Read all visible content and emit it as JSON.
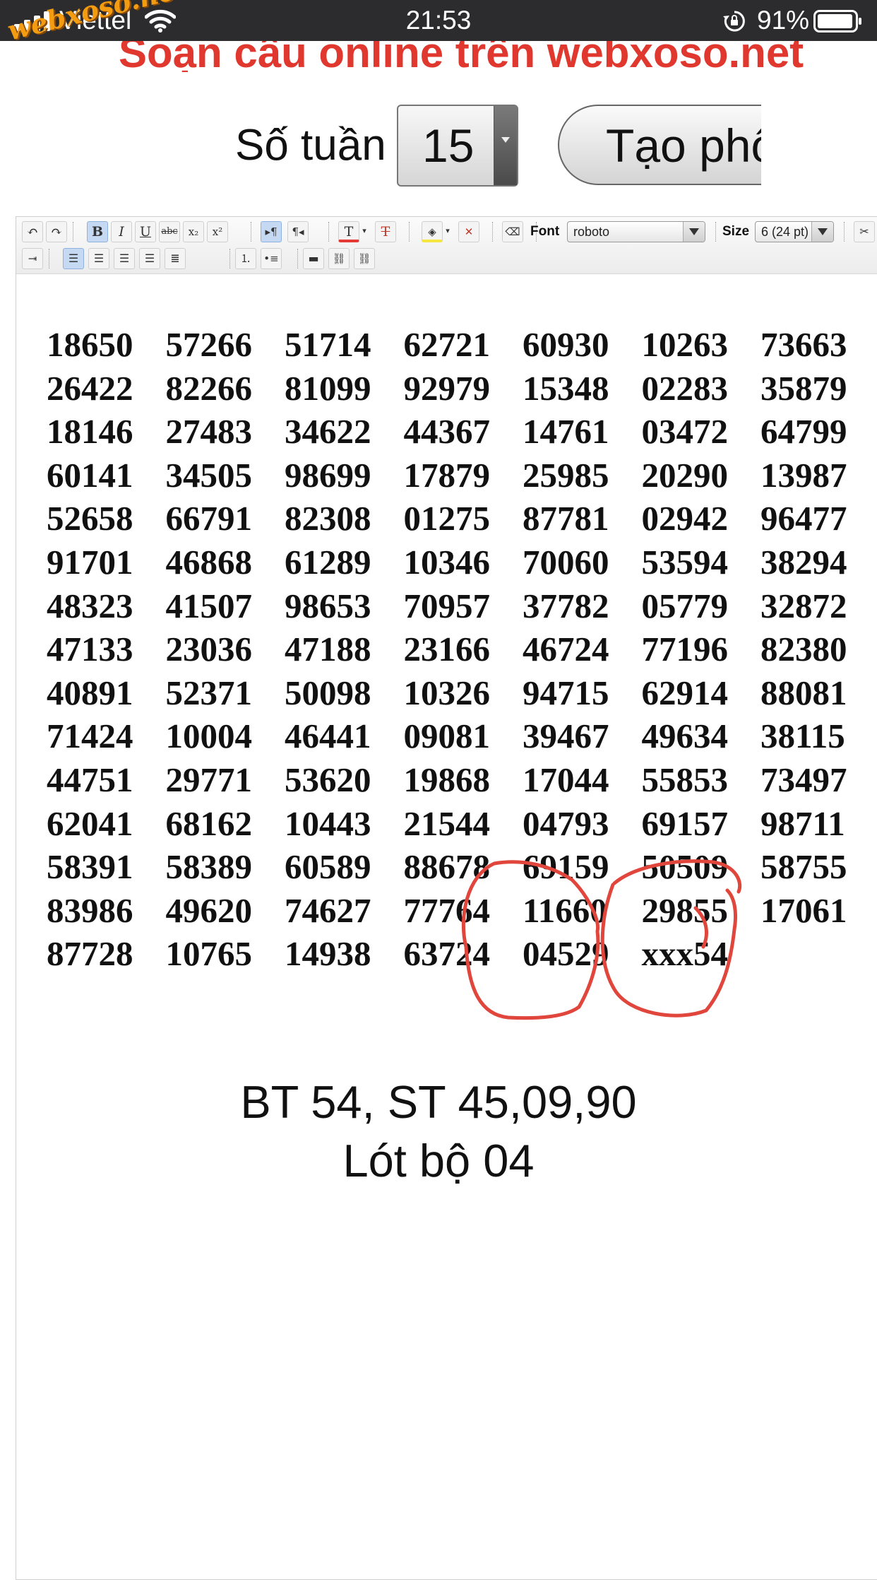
{
  "status_bar": {
    "carrier": "Viettel",
    "time": "21:53",
    "battery": "91%"
  },
  "watermark": "webxoso.net",
  "banner": "Soạn cầu online trên webxoso.net",
  "controls": {
    "weeks_label": "Số tuần",
    "weeks_value": "15",
    "create_button": "Tạo phôi"
  },
  "toolbar": {
    "font_label": "Font",
    "font_value": "roboto",
    "size_label": "Size",
    "size_value": "6 (24 pt)"
  },
  "numbers": [
    [
      "18650",
      "57266",
      "51714",
      "62721",
      "60930",
      "10263",
      "73663"
    ],
    [
      "26422",
      "82266",
      "81099",
      "92979",
      "15348",
      "02283",
      "35879"
    ],
    [
      "18146",
      "27483",
      "34622",
      "44367",
      "14761",
      "03472",
      "64799"
    ],
    [
      "60141",
      "34505",
      "98699",
      "17879",
      "25985",
      "20290",
      "13987"
    ],
    [
      "52658",
      "66791",
      "82308",
      "01275",
      "87781",
      "02942",
      "96477"
    ],
    [
      "91701",
      "46868",
      "61289",
      "10346",
      "70060",
      "53594",
      "38294"
    ],
    [
      "48323",
      "41507",
      "98653",
      "70957",
      "37782",
      "05779",
      "32872"
    ],
    [
      "47133",
      "23036",
      "47188",
      "23166",
      "46724",
      "77196",
      "82380"
    ],
    [
      "40891",
      "52371",
      "50098",
      "10326",
      "94715",
      "62914",
      "88081"
    ],
    [
      "71424",
      "10004",
      "46441",
      "09081",
      "39467",
      "49634",
      "38115"
    ],
    [
      "44751",
      "29771",
      "53620",
      "19868",
      "17044",
      "55853",
      "73497"
    ],
    [
      "62041",
      "68162",
      "10443",
      "21544",
      "04793",
      "69157",
      "98711"
    ],
    [
      "58391",
      "58389",
      "60589",
      "88678",
      "69159",
      "50509",
      "58755"
    ],
    [
      "83986",
      "49620",
      "74627",
      "77764",
      "11660",
      "29855",
      "17061"
    ],
    [
      "87728",
      "10765",
      "14938",
      "63724",
      "04529",
      "xxx54"
    ]
  ],
  "result": {
    "line1": "BT 54, ST 45,09,90",
    "line2": "Lót bộ 04"
  },
  "colors": {
    "banner_red": "#e0382e",
    "annotation_red": "#e0463c",
    "watermark_orange": "#f39c12"
  }
}
